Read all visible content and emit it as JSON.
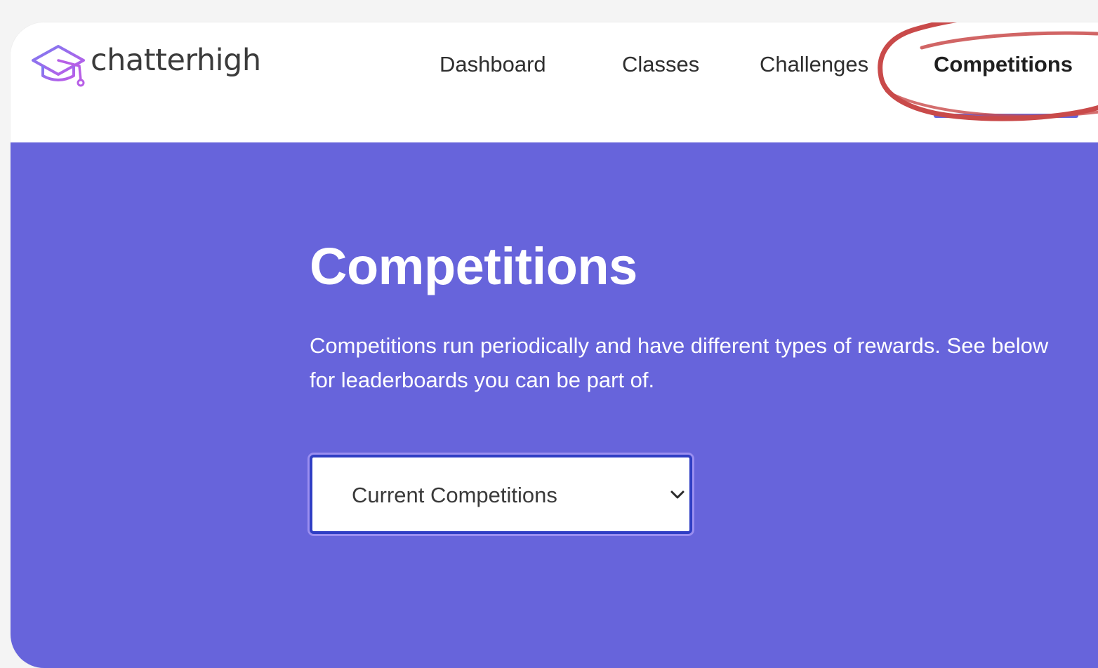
{
  "brand": {
    "name": "chatterhigh",
    "accent": "#6764db",
    "logo_purple": "#a55fe8",
    "logo_icon": "graduation-cap-icon"
  },
  "nav": {
    "items": [
      {
        "label": "Dashboard",
        "active": false
      },
      {
        "label": "Classes",
        "active": false
      },
      {
        "label": "Challenges",
        "active": false
      },
      {
        "label": "Competitions",
        "active": true
      }
    ],
    "annotation_color": "#c94a4a"
  },
  "hero": {
    "title": "Competitions",
    "description": "Competitions run periodically and have different types of rewards. See below for leaderboards you can be part of.",
    "background": "#6764db"
  },
  "filter": {
    "selected": "Current Competitions",
    "icon": "chevron-down-icon"
  }
}
